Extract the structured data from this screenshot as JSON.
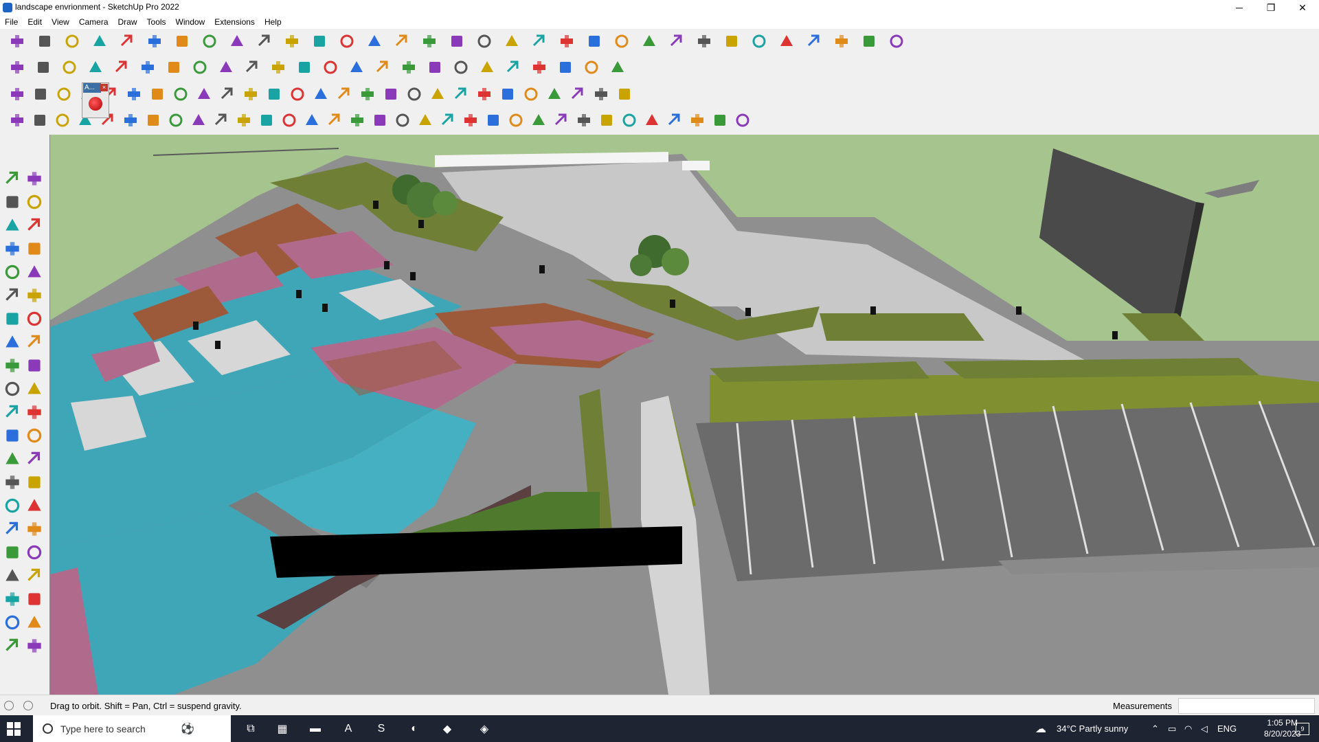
{
  "window": {
    "title": "landscape envrionment - SketchUp Pro 2022",
    "minimize": "─",
    "restore": "❐",
    "close": "✕"
  },
  "menu": [
    "File",
    "Edit",
    "View",
    "Camera",
    "Draw",
    "Tools",
    "Window",
    "Extensions",
    "Help"
  ],
  "toolbar": {
    "row1": [
      "zoom-icon",
      "select-icon",
      "eraser-icon",
      "pencil-icon",
      "lasso-icon",
      "paint-icon",
      "push-pull-icon",
      "follow-icon",
      "move-icon",
      "rotate-icon",
      "scale-icon",
      "tape-icon",
      "text-icon",
      "protractor-icon",
      "orbit-icon",
      "pan-icon",
      "zoom-window-icon",
      "zoom-extents-icon",
      "iso-view-icon",
      "top-view-icon",
      "front-view-icon",
      "section-icon",
      "style-icon",
      "layers-icon",
      "component-icon",
      "flip-icon",
      "arrows-up-icon",
      "arrows-down-icon",
      "intersect-icon",
      "solid-icon",
      "undo-icon",
      "redo-icon",
      "camera-icon"
    ],
    "row2": [
      "box-icon",
      "sphere-icon",
      "cylinder-icon",
      "extrude-icon",
      "push-icon",
      "pull-icon",
      "shell-icon",
      "bend-icon",
      "stair-icon",
      "window-icon",
      "door-icon",
      "house-icon",
      "roof-icon",
      "fence-icon",
      "rope-icon",
      "knife-icon",
      "polygon-icon",
      "octagon-icon",
      "circle-icon",
      "ellipse-icon",
      "arc-icon",
      "brush-icon",
      "fill-icon",
      "measure-icon"
    ],
    "row3": [
      "plane-icon",
      "face-icon",
      "layer-icon",
      "loop-icon",
      "square-icon",
      "grid-icon",
      "curve-icon",
      "box3d-icon",
      "arc-icon",
      "node-icon",
      "plus-icon",
      "cross-icon",
      "cone-icon",
      "pyramid-icon",
      "spiral-icon",
      "gear-icon",
      "target-icon",
      "cube-icon",
      "undo-curve-icon",
      "tree-icon",
      "pattern-icon",
      "texture-icon",
      "brick-icon",
      "tile-icon",
      "sparkle-icon",
      "dots-icon",
      "move-grid-icon"
    ],
    "row4": [
      "path-icon",
      "spline-icon",
      "car-icon",
      "sweep-icon",
      "loft-icon",
      "twist-icon",
      "skin-icon",
      "lattice-icon",
      "joint-icon",
      "line-icon",
      "bezier-icon",
      "frame-icon",
      "slope-icon",
      "column-icon",
      "rail-icon",
      "hand-icon",
      "leaf-icon",
      "arrow-icon",
      "stack-icon",
      "ramp-icon",
      "bridge-icon",
      "stair-icon",
      "barrier-icon",
      "wall-icon",
      "fence2-icon",
      "grill-icon",
      "panel-icon",
      "shutter-icon",
      "mesh-icon",
      "louver-icon",
      "brace-icon",
      "truss-icon",
      "tag-icon"
    ],
    "floating_label": "A..."
  },
  "status": {
    "hint": "Drag to orbit. Shift = Pan, Ctrl = suspend gravity.",
    "measurements_label": "Measurements",
    "measurements_value": ""
  },
  "taskbar": {
    "search_placeholder": "Type here to search",
    "weather": "34°C  Partly sunny",
    "lang": "ENG",
    "time": "1:05 PM",
    "date": "8/20/2023",
    "notifications": "9"
  },
  "colors": {
    "sky": "#a6c48e",
    "water": "#3fa6b7",
    "paving": "#8a8a8a",
    "plaza": "#c9c9c9",
    "lawn": "#7a8c3a",
    "brick": "#9c5a3a",
    "pink_paving": "#b06b8c"
  }
}
